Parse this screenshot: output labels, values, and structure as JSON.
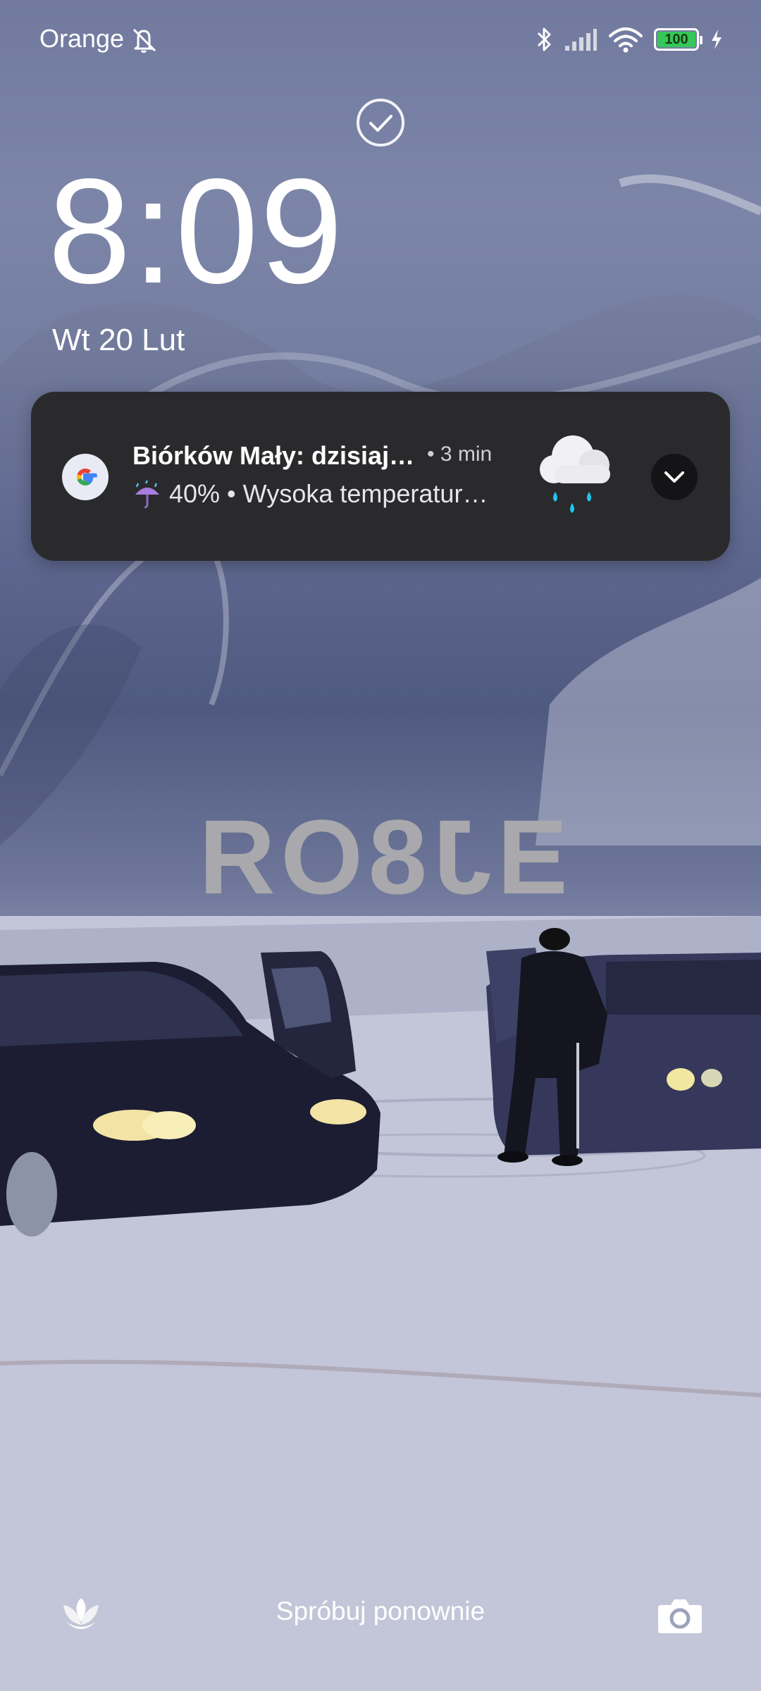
{
  "status_bar": {
    "carrier": "Orange",
    "battery_level": "100",
    "icons": [
      "mute-bell-icon",
      "bluetooth-icon",
      "cellular-signal-icon",
      "wifi-icon",
      "battery-icon",
      "charging-bolt-icon"
    ]
  },
  "lockscreen": {
    "time": "8:09",
    "date": "Wt 20 Lut",
    "retry_label": "Spróbuj ponownie"
  },
  "notification": {
    "app_icon": "google-icon",
    "title": "Biórków Mały: dzisiaj…",
    "time": "• 3 min",
    "body_text": "40% • Wysoka temperatur…",
    "weather_icon": "rain-cloud-icon"
  },
  "wallpaper": {
    "text": "ƎJ8OЯ"
  },
  "colors": {
    "notification_bg": "#2a2a2c",
    "battery_fill": "#35c759",
    "rain_drop": "#1fc6ee"
  }
}
